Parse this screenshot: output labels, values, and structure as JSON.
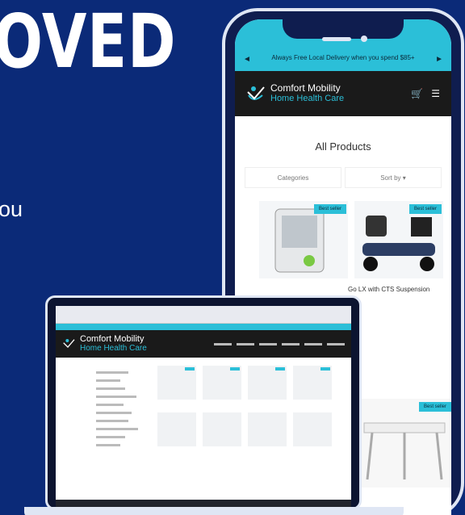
{
  "headline": "OVED",
  "side_text": "ou",
  "phone": {
    "promo": "Always Free Local Delivery when you spend $85+",
    "brand": {
      "name": "Comfort Mobility",
      "sub": "Home Health Care"
    },
    "cart_icon": "cart-icon",
    "menu_icon": "hamburger-menu-icon",
    "page_title": "All Products",
    "filters": {
      "categories": "Categories",
      "sort": "Sort by ▾"
    },
    "badges": [
      "Best seller",
      "Best seller",
      "Best seller"
    ],
    "product_caption": "Go LX with CTS Suspension"
  },
  "laptop": {
    "brand": {
      "name": "Comfort Mobility",
      "sub": "Home Health Care"
    }
  },
  "colors": {
    "background": "#0b2a78",
    "accent": "#2bbfd8",
    "header": "#1a1a1a"
  }
}
